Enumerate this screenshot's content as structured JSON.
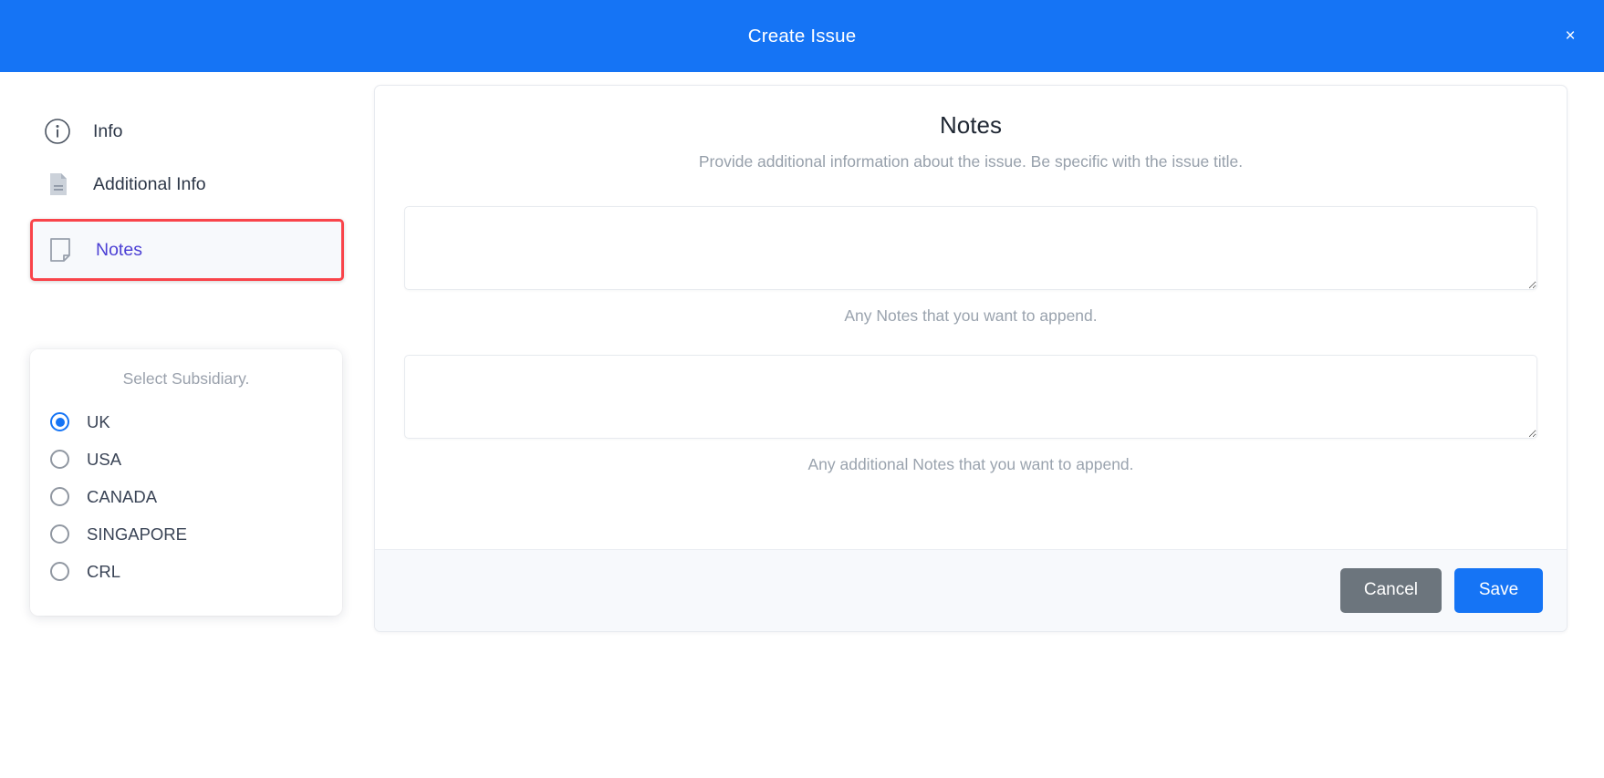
{
  "header": {
    "title": "Create Issue",
    "close_label": "×"
  },
  "sidebar": {
    "items": [
      {
        "label": "Info",
        "icon": "info-circle-icon",
        "active": false
      },
      {
        "label": "Additional Info",
        "icon": "document-lines-icon",
        "active": false
      },
      {
        "label": "Notes",
        "icon": "note-page-icon",
        "active": true
      }
    ]
  },
  "subsidiary": {
    "legend": "Select Subsidiary.",
    "options": [
      {
        "label": "UK",
        "checked": true
      },
      {
        "label": "USA",
        "checked": false
      },
      {
        "label": "CANADA",
        "checked": false
      },
      {
        "label": "SINGAPORE",
        "checked": false
      },
      {
        "label": "CRL",
        "checked": false
      }
    ]
  },
  "main": {
    "title": "Notes",
    "subtitle": "Provide additional information about the issue. Be specific with the issue title.",
    "fields": [
      {
        "name": "notes",
        "value": "",
        "placeholder": "",
        "help": "Any Notes that you want to append."
      },
      {
        "name": "additional-notes",
        "value": "",
        "placeholder": "",
        "help": "Any additional Notes that you want to append."
      }
    ]
  },
  "footer": {
    "cancel_label": "Cancel",
    "save_label": "Save"
  },
  "colors": {
    "header_blue": "#1574f5",
    "primary_blue": "#1574f5",
    "cancel_gray": "#6c757d",
    "highlight_red": "#f9444a",
    "active_link": "#4b3fd4"
  }
}
